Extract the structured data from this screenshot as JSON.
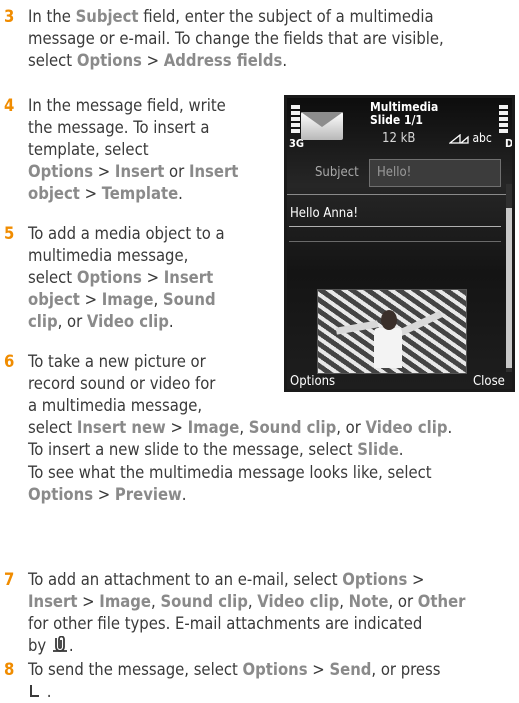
{
  "steps": [
    {
      "number": "3",
      "lines": [
        [
          {
            "t": "In the "
          },
          {
            "t": "Subject",
            "k": 1
          },
          {
            "t": " field, enter the subject of a multimedia"
          }
        ],
        [
          {
            "t": "message or e-mail. To change the fields that are visible,"
          }
        ],
        [
          {
            "t": "select "
          },
          {
            "t": "Options",
            "k": 1
          },
          {
            "t": " > "
          },
          {
            "t": "Address fields",
            "k": 1
          },
          {
            "t": "."
          }
        ]
      ]
    },
    {
      "number": "4",
      "lines": [
        [
          {
            "t": "In the message field, write"
          }
        ],
        [
          {
            "t": "the message. To insert a"
          }
        ],
        [
          {
            "t": "template, select"
          }
        ],
        [
          {
            "t": "Options",
            "k": 1
          },
          {
            "t": " > "
          },
          {
            "t": "Insert",
            "k": 1
          },
          {
            "t": " or "
          },
          {
            "t": "Insert",
            "k": 1
          }
        ],
        [
          {
            "t": "object",
            "k": 1
          },
          {
            "t": " > "
          },
          {
            "t": "Template",
            "k": 1
          },
          {
            "t": "."
          }
        ]
      ]
    },
    {
      "number": "5",
      "lines": [
        [
          {
            "t": "To add a media object to a"
          }
        ],
        [
          {
            "t": "multimedia message,"
          }
        ],
        [
          {
            "t": "select "
          },
          {
            "t": "Options",
            "k": 1
          },
          {
            "t": " > "
          },
          {
            "t": "Insert",
            "k": 1
          }
        ],
        [
          {
            "t": "object",
            "k": 1
          },
          {
            "t": " > "
          },
          {
            "t": "Image",
            "k": 1
          },
          {
            "t": ", "
          },
          {
            "t": "Sound",
            "k": 1
          }
        ],
        [
          {
            "t": "clip",
            "k": 1
          },
          {
            "t": ", or "
          },
          {
            "t": "Video clip",
            "k": 1
          },
          {
            "t": "."
          }
        ]
      ]
    },
    {
      "number": "6",
      "lines": [
        [
          {
            "t": "To take a new picture or"
          }
        ],
        [
          {
            "t": "record sound or video for"
          }
        ],
        [
          {
            "t": "a multimedia message,"
          }
        ],
        [
          {
            "t": "select "
          },
          {
            "t": "Insert new",
            "k": 1
          },
          {
            "t": " > "
          },
          {
            "t": "Image",
            "k": 1
          },
          {
            "t": ", "
          },
          {
            "t": "Sound clip",
            "k": 1
          },
          {
            "t": ", or "
          },
          {
            "t": "Video clip",
            "k": 1
          },
          {
            "t": "."
          }
        ],
        [
          {
            "t": "To insert a new slide to the message, select "
          },
          {
            "t": "Slide",
            "k": 1
          },
          {
            "t": "."
          }
        ],
        [
          {
            "t": "To see what the multimedia message looks like, select"
          }
        ],
        [
          {
            "t": "Options",
            "k": 1
          },
          {
            "t": " > "
          },
          {
            "t": "Preview",
            "k": 1
          },
          {
            "t": "."
          }
        ]
      ]
    },
    {
      "number": "7",
      "lines": [
        [
          {
            "t": "To add an attachment to an e-mail, select "
          },
          {
            "t": "Options",
            "k": 1
          },
          {
            "t": " >"
          }
        ],
        [
          {
            "t": "Insert",
            "k": 1
          },
          {
            "t": " > "
          },
          {
            "t": "Image",
            "k": 1
          },
          {
            "t": ", "
          },
          {
            "t": "Sound clip",
            "k": 1
          },
          {
            "t": ", "
          },
          {
            "t": "Video clip",
            "k": 1
          },
          {
            "t": ", "
          },
          {
            "t": "Note",
            "k": 1
          },
          {
            "t": ", or "
          },
          {
            "t": "Other",
            "k": 1
          }
        ],
        [
          {
            "t": "for other file types. E-mail attachments are indicated"
          }
        ],
        [
          {
            "t": "by "
          },
          {
            "icon": "paperclip-icon"
          },
          {
            "t": "."
          }
        ]
      ]
    },
    {
      "number": "8",
      "lines": [
        [
          {
            "t": "To send the message, select "
          },
          {
            "t": "Options",
            "k": 1
          },
          {
            "t": " > "
          },
          {
            "t": "Send",
            "k": 1
          },
          {
            "t": ", or press"
          }
        ],
        [
          {
            "icon": "call-key-icon"
          },
          {
            "t": " ."
          }
        ]
      ]
    }
  ],
  "phone": {
    "title": "Multimedia",
    "slide": "Slide 1/1",
    "size": "12 kB",
    "network": "3G",
    "input_mode": "abc",
    "subject_label": "Subject",
    "subject_value": "Hello!",
    "message_text": "Hello Anna!",
    "left_softkey": "Options",
    "right_softkey": "Close"
  }
}
